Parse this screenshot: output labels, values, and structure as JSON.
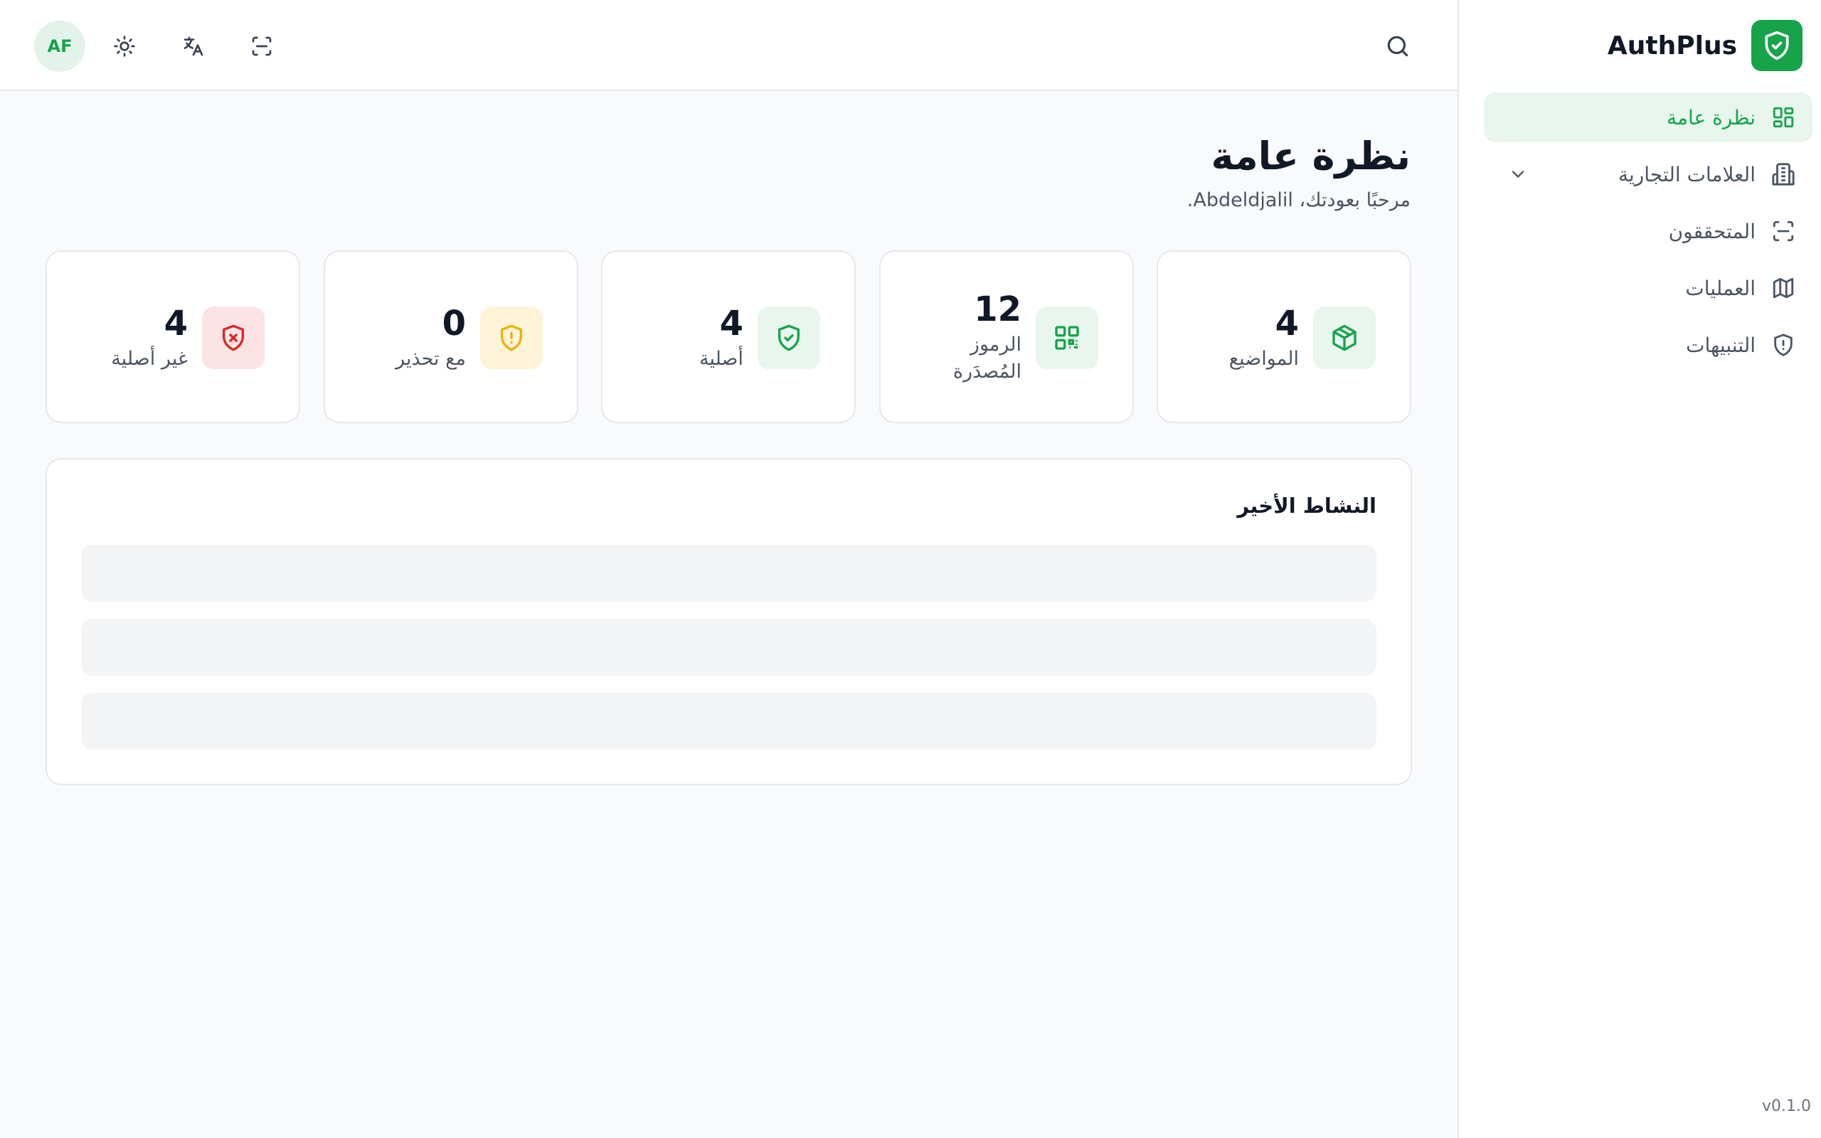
{
  "brand": {
    "name": "AuthPlus",
    "color": "#16a34a"
  },
  "sidebar": {
    "items": [
      {
        "label": "نظرة عامة",
        "icon": "dashboard-icon",
        "active": true
      },
      {
        "label": "العلامات التجارية",
        "icon": "building-icon",
        "expandable": true
      },
      {
        "label": "المتحققون",
        "icon": "scan-icon"
      },
      {
        "label": "العمليات",
        "icon": "map-icon"
      },
      {
        "label": "التنبيهات",
        "icon": "shield-alert-icon"
      }
    ],
    "version": "v0.1.0"
  },
  "topbar": {
    "avatar_initials": "AF",
    "icons": [
      "sun-icon",
      "translate-icon",
      "scan-icon",
      "search-icon"
    ]
  },
  "main": {
    "title": "نظرة عامة",
    "welcome": "مرحبًا بعودتك، Abdeldjalil.",
    "stats": [
      {
        "value": "4",
        "label": "المواضيع",
        "icon": "box-icon",
        "color": "#16a34a",
        "bg": "#e8f6ee"
      },
      {
        "value": "12",
        "label": "الرموز المُصدَرة",
        "icon": "qr-code-icon",
        "color": "#16a34a",
        "bg": "#e8f6ee"
      },
      {
        "value": "4",
        "label": "أصلية",
        "icon": "shield-check-icon",
        "color": "#16a34a",
        "bg": "#e8f6ee"
      },
      {
        "value": "0",
        "label": "مع تحذير",
        "icon": "shield-warning-icon",
        "color": "#eab308",
        "bg": "#fef3d8"
      },
      {
        "value": "4",
        "label": "غير أصلية",
        "icon": "shield-x-icon",
        "color": "#dc2626",
        "bg": "#fde4e4"
      }
    ],
    "activity": {
      "title": "النشاط الأخير"
    }
  }
}
